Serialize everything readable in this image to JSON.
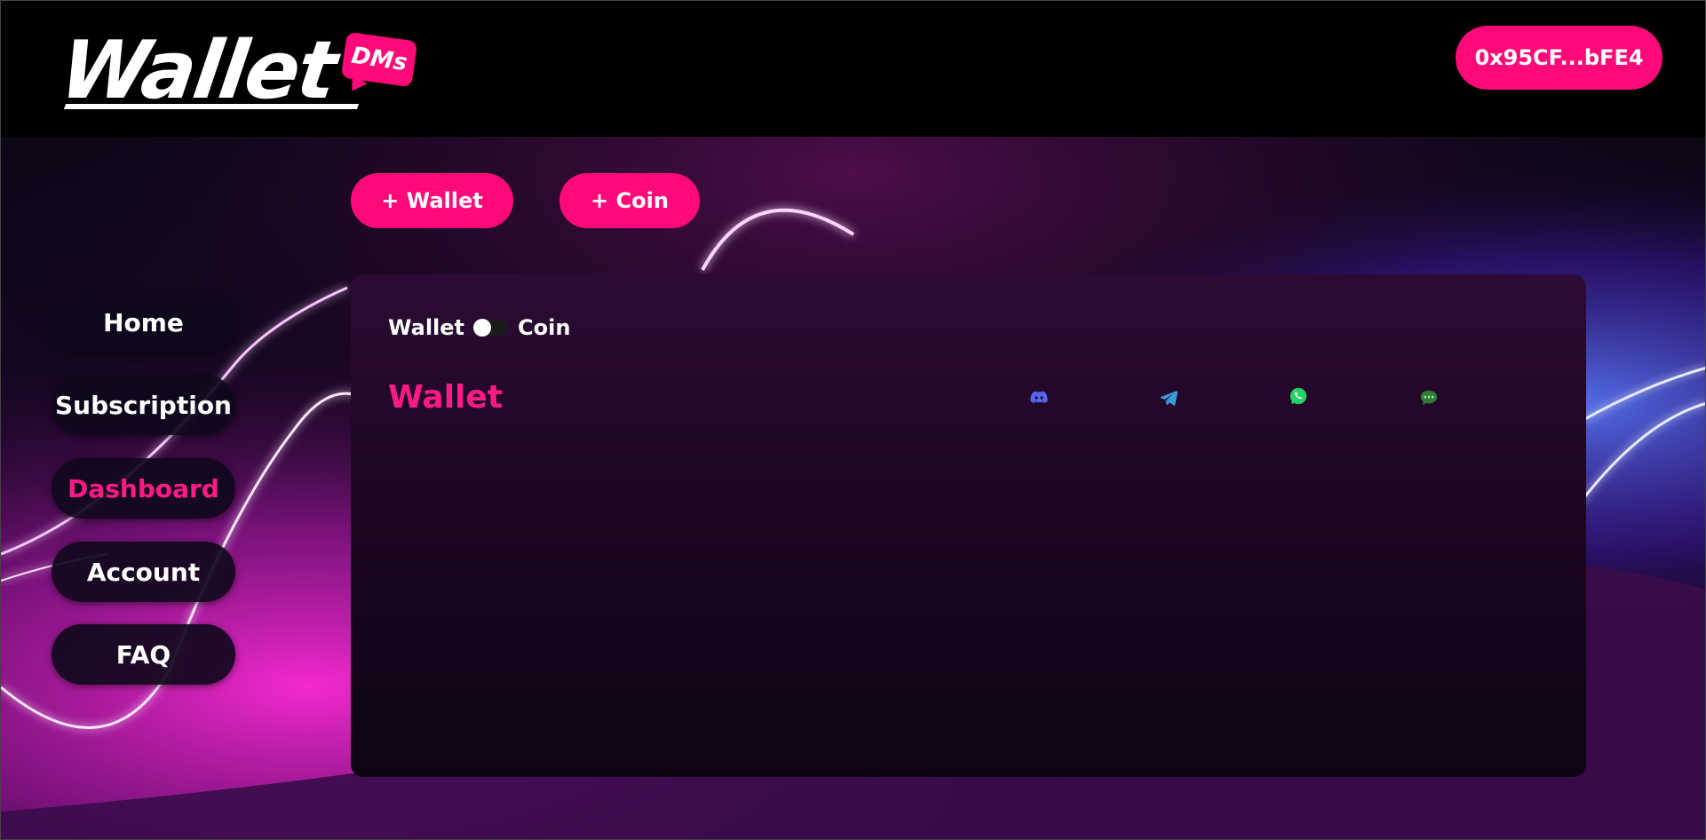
{
  "header": {
    "logo_text": "Wallet",
    "logo_badge": "DMs",
    "wallet_address": "0x95CF...bFE4"
  },
  "actions": {
    "add_wallet": "+ Wallet",
    "add_coin": "+ Coin"
  },
  "sidebar": {
    "items": [
      {
        "label": "Home"
      },
      {
        "label": "Subscription"
      },
      {
        "label": "Dashboard",
        "active": true
      },
      {
        "label": "Account"
      },
      {
        "label": "FAQ"
      }
    ]
  },
  "panel": {
    "toggle_left": "Wallet",
    "toggle_right": "Coin",
    "title": "Wallet",
    "channels": [
      "discord-icon",
      "telegram-icon",
      "whatsapp-icon",
      "sms-icon"
    ]
  },
  "colors": {
    "accent": "#ff0a78",
    "panel_bg": "#1c0722",
    "discord": "#5865f2",
    "telegram": "#3a9bdc",
    "whatsapp": "#25d366",
    "sms": "#2e7d32"
  }
}
